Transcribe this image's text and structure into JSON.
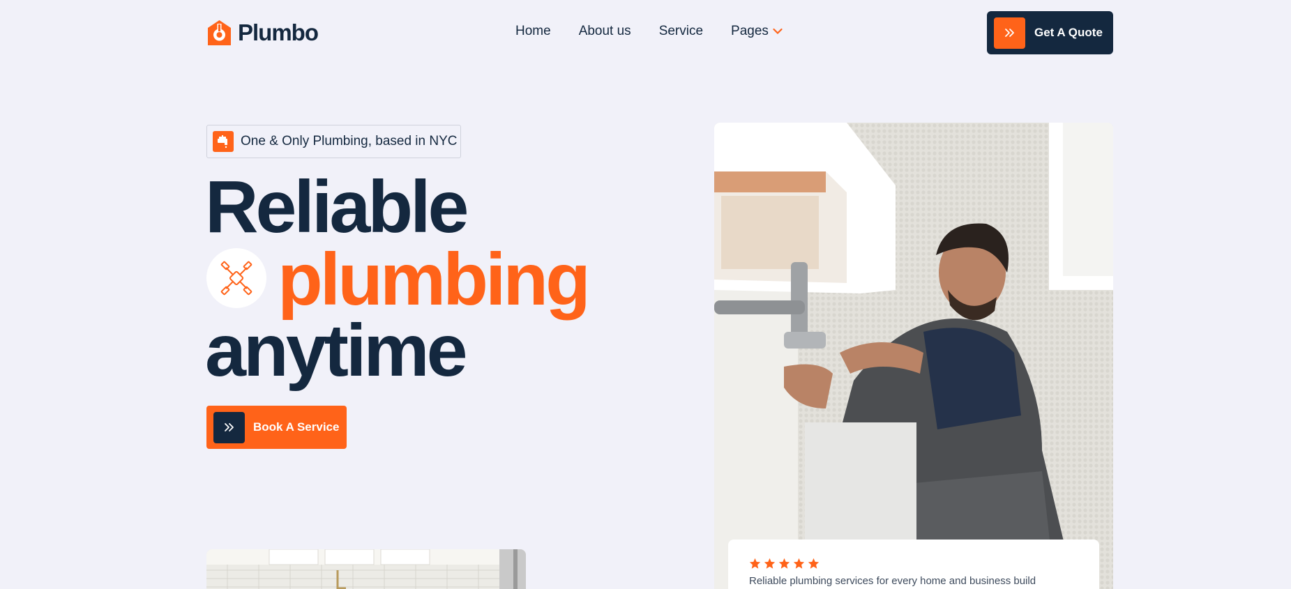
{
  "brand": {
    "name": "Plumbo",
    "accent_color": "#ff6319",
    "dark_color": "#14283f",
    "background_color": "#f1f1f9"
  },
  "nav": {
    "items": [
      {
        "label": "Home"
      },
      {
        "label": "About us"
      },
      {
        "label": "Service"
      },
      {
        "label": "Pages",
        "has_dropdown": true
      }
    ]
  },
  "header": {
    "quote_button_label": "Get A Quote",
    "quote_button_icon": "double-chevron-right-icon"
  },
  "hero": {
    "badge_icon": "faucet-icon",
    "badge_text": "One & Only Plumbing, based in NYC",
    "headline_line1": "Reliable",
    "headline_line2": "plumbing",
    "headline_line3": "anytime",
    "headline_decoration_icon": "pipe-cross-icon",
    "cta_label": "Book A Service",
    "cta_icon": "double-chevron-right-icon",
    "image_icon": "plumber-photo"
  },
  "review": {
    "rating": 5,
    "max_rating": 5,
    "text": "Reliable plumbing services for every home and business build"
  }
}
